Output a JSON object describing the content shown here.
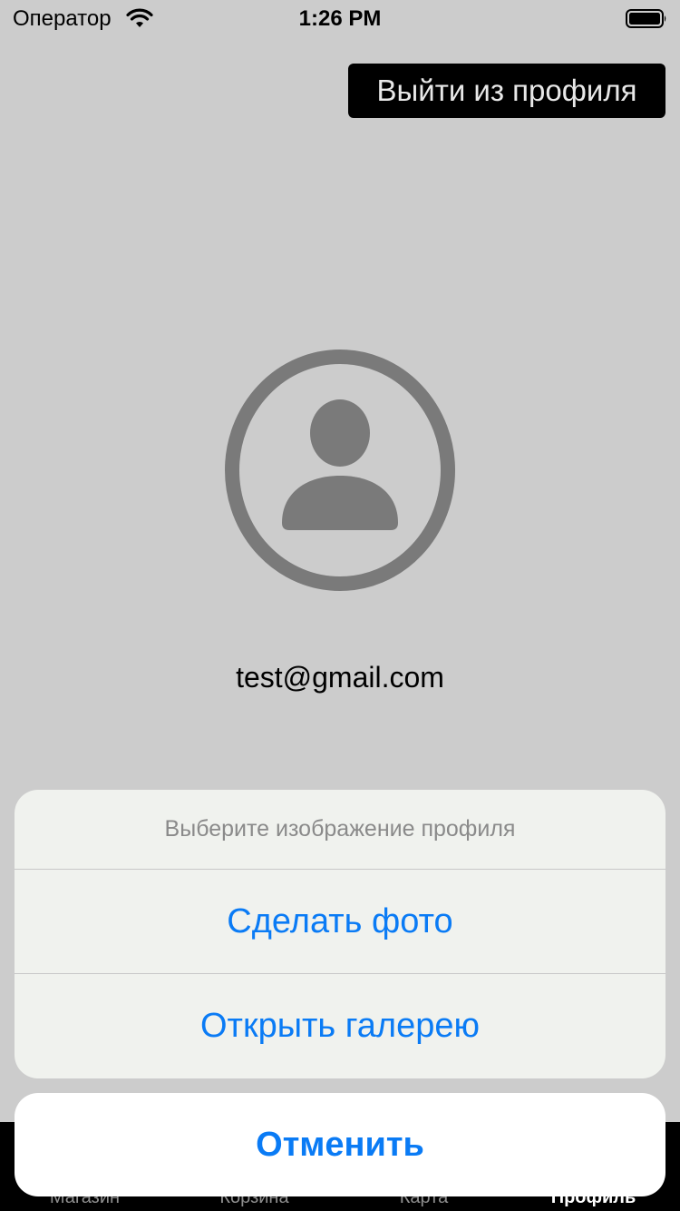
{
  "status_bar": {
    "carrier": "Оператор",
    "time": "1:26 PM",
    "wifi_icon": "wifi-icon",
    "battery_icon": "battery-icon"
  },
  "header": {
    "logout_label": "Выйти из профиля"
  },
  "profile": {
    "avatar_icon": "person-circle-icon",
    "email": "test@gmail.com"
  },
  "tab_bar": {
    "items": [
      {
        "label": "Магазин",
        "active": false
      },
      {
        "label": "Корзина",
        "active": false
      },
      {
        "label": "Карта",
        "active": false
      },
      {
        "label": "Профиль",
        "active": true
      }
    ]
  },
  "action_sheet": {
    "title": "Выберите изображение профиля",
    "actions": [
      {
        "label": "Сделать фото"
      },
      {
        "label": "Открыть галерею"
      }
    ],
    "cancel_label": "Отменить"
  },
  "colors": {
    "background": "#cccccc",
    "accent": "#0a7bf5",
    "avatar": "#7a7a7a"
  }
}
